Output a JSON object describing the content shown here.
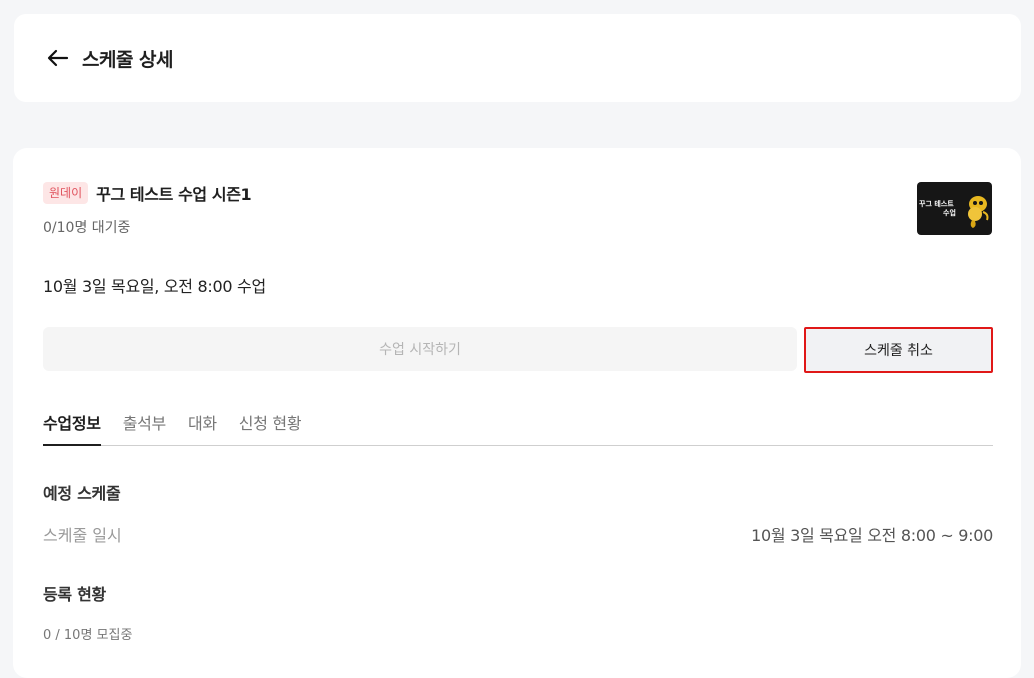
{
  "header": {
    "title": "스케줄 상세",
    "back_icon": "arrow-left-icon"
  },
  "class": {
    "badge": "원데이",
    "title": "꾸그 테스트 수업 시즌1",
    "waiting": "0/10명 대기중",
    "thumbnail_text_line1": "꾸그 테스트",
    "thumbnail_text_line2": "수업",
    "schedule": "10월 3일 목요일, 오전 8:00 수업"
  },
  "actions": {
    "start_label": "수업 시작하기",
    "cancel_label": "스케줄 취소"
  },
  "tabs": [
    {
      "label": "수업정보",
      "active": true
    },
    {
      "label": "출석부",
      "active": false
    },
    {
      "label": "대화",
      "active": false
    },
    {
      "label": "신청 현황",
      "active": false
    }
  ],
  "upcoming": {
    "section_title": "예정 스케줄",
    "label": "스케줄 일시",
    "value": "10월 3일 목요일 오전 8:00 ~ 9:00"
  },
  "registration": {
    "section_title": "등록 현황",
    "status": "0 / 10명 모집중"
  },
  "colors": {
    "badge_bg": "#fde6e6",
    "badge_text": "#e0525d",
    "highlight_border": "#e01818"
  }
}
